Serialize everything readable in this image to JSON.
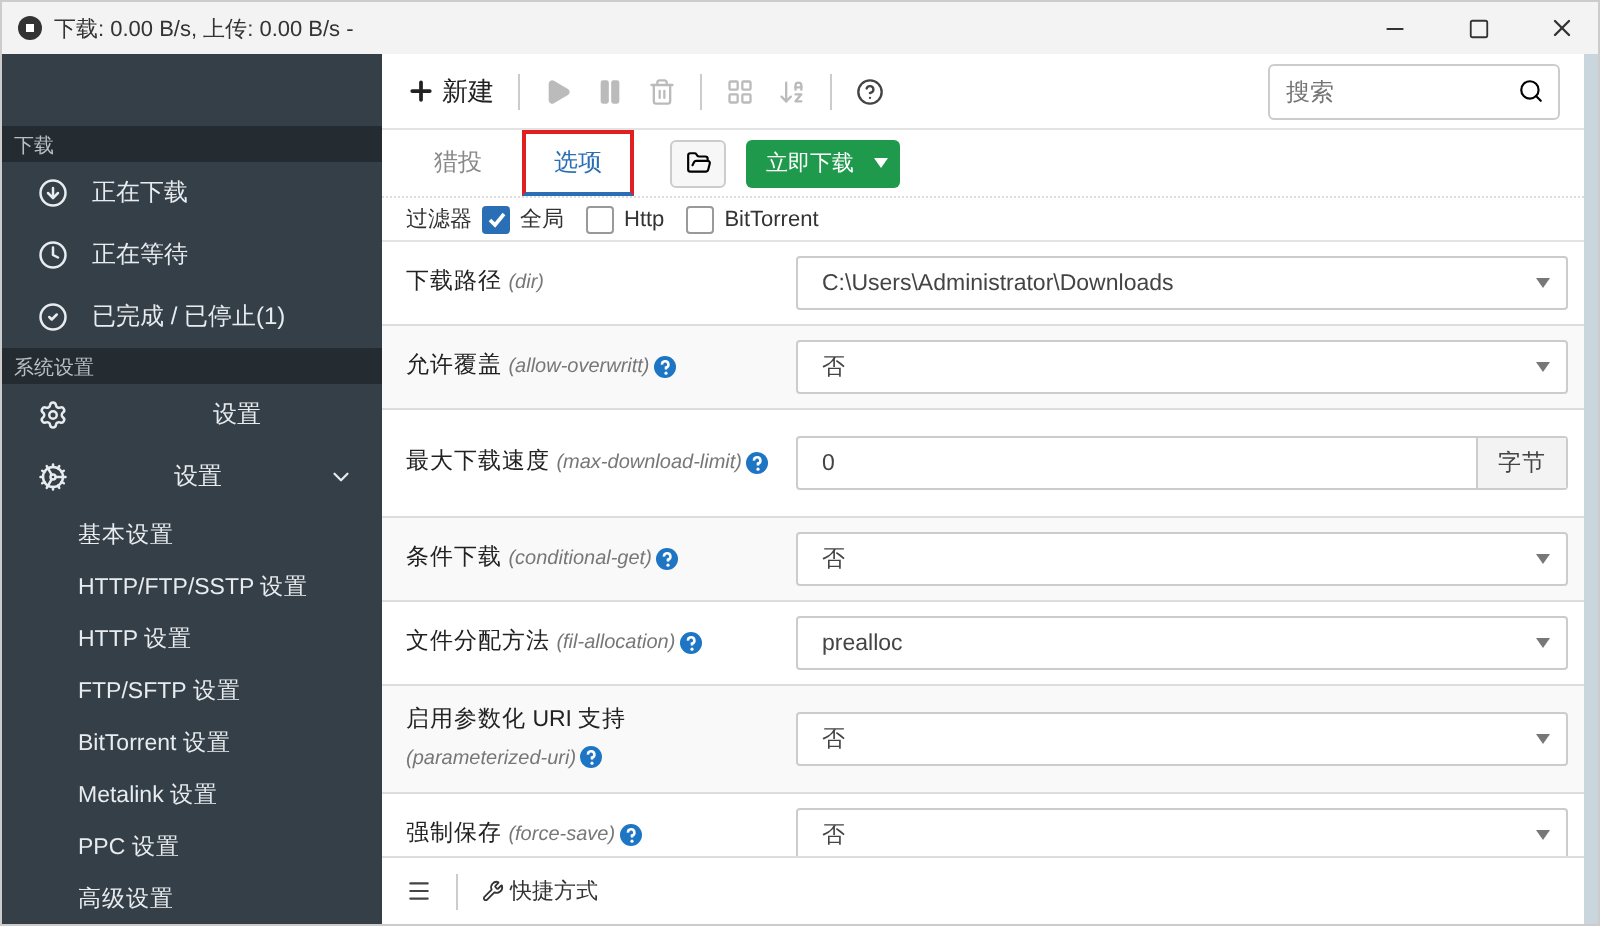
{
  "window": {
    "title": "下载: 0.00 B/s, 上传: 0.00 B/s -"
  },
  "sidebar": {
    "sections": [
      {
        "header": "下载",
        "items": [
          {
            "label": "正在下载",
            "selected": false
          },
          {
            "label": "正在等待",
            "selected": false
          },
          {
            "label": "已完成 / 已停止(1)",
            "selected": false
          }
        ]
      },
      {
        "header": "系统设置",
        "items": [
          {
            "label": "设置",
            "selected": false
          },
          {
            "label": "设置",
            "expanded": true,
            "selected": false,
            "children": [
              {
                "label": "基本设置"
              },
              {
                "label": "HTTP/FTP/SSTP 设置"
              },
              {
                "label": "HTTP 设置"
              },
              {
                "label": "FTP/SFTP 设置"
              },
              {
                "label": "BitTorrent 设置"
              },
              {
                "label": "Metalink 设置"
              },
              {
                "label": "PPC 设置"
              },
              {
                "label": "高级设置"
              }
            ]
          }
        ]
      }
    ]
  },
  "toolbar": {
    "new_label": "新建",
    "search": {
      "placeholder": "搜索"
    }
  },
  "tabs": [
    {
      "label": "猎投",
      "selected": false,
      "highlighted": false
    },
    {
      "label": "选项",
      "selected": true,
      "highlighted": true
    }
  ],
  "start_button": "立即下载",
  "filter": {
    "label": "过滤器",
    "options": [
      {
        "label": "全局",
        "checked": true
      },
      {
        "label": "Http",
        "checked": false
      },
      {
        "label": "BitTorrent",
        "checked": false
      }
    ]
  },
  "options": [
    {
      "label": "下载路径",
      "key": "(dir)",
      "help": false,
      "kind": "select",
      "value": "C:\\Users\\Administrator\\Downloads"
    },
    {
      "label": "允许覆盖",
      "key": "(allow-overwritt)",
      "help": true,
      "kind": "select",
      "value": "否"
    },
    {
      "label": "最大下载速度",
      "key": "(max-download-limit)",
      "help": true,
      "kind": "unit",
      "value": "0",
      "unit": "字节"
    },
    {
      "label": "条件下载",
      "key": "(conditional-get)",
      "help": true,
      "kind": "select",
      "value": "否"
    },
    {
      "label": "文件分配方法",
      "key": "(fil-allocation)",
      "help": true,
      "kind": "select",
      "value": "prealloc"
    },
    {
      "label": "启用参数化 URI 支持",
      "key": "(parameterized-uri)",
      "help": true,
      "kind": "select",
      "value": "否"
    },
    {
      "label": "强制保存",
      "key": "(force-save)",
      "help": true,
      "kind": "select",
      "value": "否"
    }
  ],
  "footer": {
    "shortcut_label": "快捷方式"
  }
}
